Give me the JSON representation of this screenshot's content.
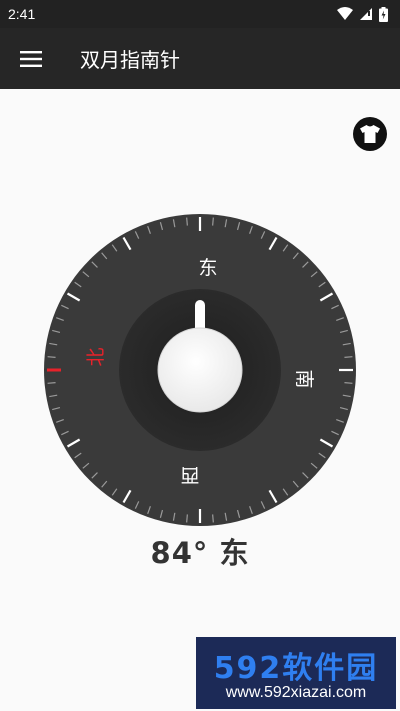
{
  "status_bar": {
    "time": "2:41"
  },
  "app_bar": {
    "title": "双月指南针"
  },
  "compass": {
    "heading_degrees": 84,
    "labels": {
      "north": "北",
      "east": "东",
      "south": "南",
      "west": "西"
    },
    "north_color": "#e8222a",
    "dial_color": "#3a3a3a",
    "knob_color": "#f5f5f5"
  },
  "heading_readout": "84° 东",
  "watermark": {
    "logo": "592软件园",
    "url": "www.592xiazai.com"
  }
}
